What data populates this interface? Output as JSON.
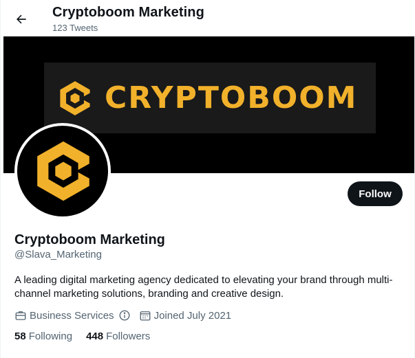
{
  "header": {
    "title": "Cryptoboom Marketing",
    "subtitle": "123 Tweets",
    "back_icon": "arrow-left-icon"
  },
  "banner": {
    "wordmark": "CRYPTOBOOM",
    "brand_color": "#f2b12b",
    "background": "#000000"
  },
  "profile": {
    "name": "Cryptoboom Marketing",
    "handle": "@Slava_Marketing",
    "bio": "A leading digital marketing agency dedicated to elevating your brand through multi-channel marketing solutions, branding and creative design.",
    "category": "Business Services",
    "joined": "Joined July 2021",
    "follow_label": "Follow"
  },
  "stats": {
    "following_count": "58",
    "following_label": "Following",
    "followers_count": "448",
    "followers_label": "Followers"
  },
  "colors": {
    "text_primary": "#0f1419",
    "text_secondary": "#536471",
    "button_bg": "#0f1419"
  }
}
